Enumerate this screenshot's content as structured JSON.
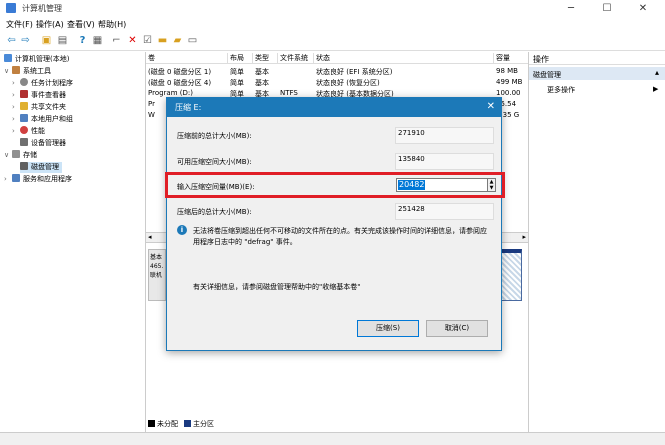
{
  "window": {
    "title": "计算机管理"
  },
  "menu": [
    "文件(F)",
    "操作(A)",
    "查看(V)",
    "帮助(H)"
  ],
  "tree": {
    "root": "计算机管理(本地)",
    "system_tools": "系统工具",
    "task_scheduler": "任务计划程序",
    "event_viewer": "事件查看器",
    "shared_folders": "共享文件夹",
    "local_users": "本地用户和组",
    "performance": "性能",
    "device_manager": "设备管理器",
    "storage": "存储",
    "disk_management": "磁盘管理",
    "services": "服务和应用程序"
  },
  "volume_table": {
    "headers": [
      "卷",
      "布局",
      "类型",
      "文件系统",
      "状态",
      "容量"
    ],
    "rows": [
      [
        "(磁盘 0 磁盘分区 1)",
        "简单",
        "基本",
        "",
        "状态良好 (EFI 系统分区)",
        "98 MB"
      ],
      [
        "(磁盘 0 磁盘分区 4)",
        "简单",
        "基本",
        "",
        "状态良好 (恢复分区)",
        "499 MB"
      ],
      [
        "Program (D:)",
        "简单",
        "基本",
        "NTFS",
        "状态良好 (基本数据分区)",
        "100.00"
      ],
      [
        "Pr",
        "",
        "",
        "",
        "",
        "65.54"
      ],
      [
        "W",
        "",
        "",
        "",
        "",
        "9.35 G"
      ]
    ]
  },
  "actions": {
    "header": "操作",
    "section": "磁盘管理",
    "more": "更多操作"
  },
  "disk_area": {
    "line1": "基本",
    "line2": "465.",
    "line3": "联机"
  },
  "legend": {
    "unallocated": "未分配",
    "primary": "主分区"
  },
  "dialog": {
    "title": "压缩 E:",
    "total_before_label": "压缩前的总计大小(MB):",
    "total_before_value": "271910",
    "available_label": "可用压缩空间大小(MB):",
    "available_value": "135840",
    "input_label": "输入压缩空间量(MB)(E):",
    "input_value": "20482",
    "total_after_label": "压缩后的总计大小(MB):",
    "total_after_value": "251428",
    "info_text": "无法将卷压缩到超出任何不可移动的文件所在的点。有关完成该操作时间的详细信息，请参阅应用程序日志中的 \"defrag\" 事件。",
    "help_text": "有关详细信息，请参阅磁盘管理帮助中的\"收缩基本卷\"",
    "ok_label": "压缩(S)",
    "cancel_label": "取消(C)"
  },
  "colors": {
    "accent": "#1c79b8",
    "highlight": "#e01e26",
    "selection": "#0078d7"
  }
}
